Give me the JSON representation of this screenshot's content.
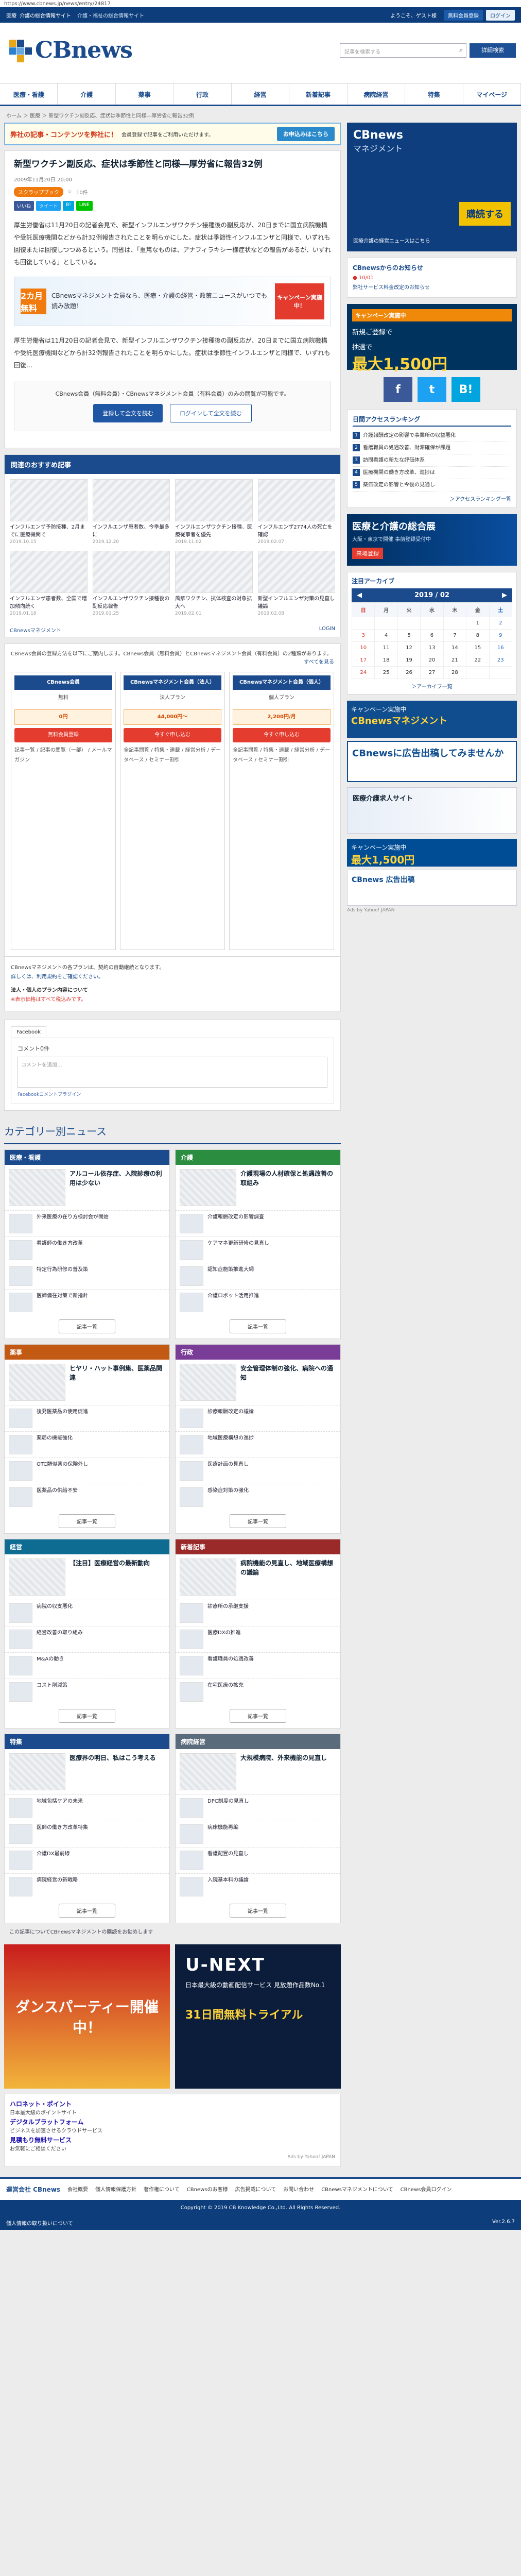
{
  "url": "https://www.cbnews.jp/news/entry/24817",
  "topbar": {
    "links": [
      "医療",
      "介護の総合情報サイト"
    ],
    "tagline": "介護・福祉の総合情報サイト",
    "welcome": "ようこそ、ゲスト様",
    "register": "無料会員登録",
    "login": "ログイン"
  },
  "header": {
    "logo_text": "CBnews",
    "search_placeholder": "記事を検索する",
    "search_button": "詳細検索"
  },
  "nav": [
    "医療・看護",
    "介護",
    "薬事",
    "行政",
    "経営",
    "新着記事",
    "病院経営",
    "特集",
    "マイページ"
  ],
  "breadcrumb": "ホーム ＞ 医療 ＞ 新型ワクチン副反応、症状は季節性と同様―厚労省に報告32例",
  "banner": {
    "title": "弊社の記事・コンテンツを弊社に！",
    "note": "会員登録で記事をご利用いただけます。",
    "cta": "お申込みはこちら"
  },
  "article": {
    "title": "新型ワクチン副反応、症状は季節性と同様―厚労省に報告32例",
    "date": "2009年11月20日 20:00",
    "tag": "スクラップブック",
    "share_count": "10件",
    "sns": [
      "いいね",
      "ツイート",
      "B!",
      "LINE"
    ],
    "body": "厚生労働省は11月20日の記者会見で、新型インフルエンザワクチン接種後の副反応が、20日までに国立病院機構や受託医療機関などから計32例報告されたことを明らかにした。症状は季節性インフルエンザと同様で、いずれも回復または回復しつつあるという。同省は、「重篤なものは、アナフィラキシー様症状などの報告があるが、いずれも回復している」としている。",
    "body2": "厚生労働省は11月20日の記者会見で、新型インフルエンザワクチン接種後の副反応が、20日までに国立病院機構や受託医療機関などから計32例報告されたことを明らかにした。症状は季節性インフルエンザと同様で、いずれも回復…",
    "promo_label": "2カ月無料",
    "promo_text": "CBnewsマネジメント会員なら、医療・介護の経営・政策ニュースがいつでも読み放題！",
    "promo_campaign": "キャンペーン実施中！",
    "login_text": "CBnews会員（無料会員）・CBnewsマネジメント会員（有料会員）のみの閲覧が可能です。",
    "login_btn1": "登録して全文を読む",
    "login_btn2": "ログインして全文を読む"
  },
  "recommended": {
    "title": "関連のおすすめ記事",
    "items": [
      {
        "text": "インフルエンザ予防接種、2月までに医療機関で",
        "date": "2019.10.15"
      },
      {
        "text": "インフルエンザ患者数、今季最多に",
        "date": "2019.12.20"
      },
      {
        "text": "インフルエンザワクチン接種、医療従事者を優先",
        "date": "2019.11.02"
      },
      {
        "text": "インフルエンザ2774人の死亡を確認",
        "date": "2019.02.07"
      },
      {
        "text": "インフルエンザ患者数、全国で増加傾向続く",
        "date": "2019.01.18"
      },
      {
        "text": "インフルエンザワクチン接種後の副反応報告",
        "date": "2019.01.25"
      },
      {
        "text": "風疹ワクチン、抗体検査の対象拡大へ",
        "date": "2019.02.01"
      },
      {
        "text": "新型インフルエンザ対策の見直し議論",
        "date": "2019.02.08"
      }
    ]
  },
  "promo_inline": {
    "left": "CBnewsマネジメント",
    "right": "LOGIN"
  },
  "plans": {
    "intro": "CBnews会員の登録方法を以下にご案内します。CBnews会員（無料会員）とCBnewsマネジメント会員（有料会員）の2種類があります。",
    "title": "すべてを見る",
    "cols": [
      {
        "head": "CBnews会員",
        "sub": "無料",
        "price": "0円",
        "cta": "無料会員登録",
        "feat": "記事一覧 / 記事の閲覧（一部） / メールマガジン"
      },
      {
        "head": "CBnewsマネジメント会員（法人）",
        "sub": "法人プラン",
        "price": "44,000円〜",
        "cta": "今すぐ申し込む",
        "feat": "全記事閲覧 / 特集・連載 / 経営分析 / データベース / セミナー割引"
      },
      {
        "head": "CBnewsマネジメント会員（個人）",
        "sub": "個人プラン",
        "price": "2,200円/月",
        "cta": "今すぐ申し込む",
        "feat": "全記事閲覧 / 特集・連載 / 経営分析 / データベース / セミナー割引"
      }
    ]
  },
  "info": {
    "line1": "CBnewsマネジメントの各プランは、契約の自動継続となります。",
    "line2": "詳しくは、利用規約をご確認ください。",
    "line3": "法人・個人のプラン内容について",
    "red": "※表示価格はすべて税込みです。"
  },
  "facebook": {
    "tab": "Facebook",
    "comments": "コメント0件",
    "placeholder": "コメントを追加...",
    "plugin": "Facebookコメントプラグイン"
  },
  "categories": {
    "title": "カテゴリー別ニュース",
    "blocks": [
      {
        "name": "医療・看護",
        "color": "#1b4b8c",
        "feat": "アルコール依存症、入院診療の利用は少ない",
        "items": [
          "外来医療の在り方検討会が開始",
          "看護師の働き方改革",
          "特定行為研修の普及策",
          "医師偏在対策で新指針"
        ],
        "more": "記事一覧"
      },
      {
        "name": "介護",
        "color": "#2a8d3f",
        "feat": "介護現場の人材確保と処遇改善の取組み",
        "items": [
          "介護報酬改定の影響調査",
          "ケアマネ更新研修の見直し",
          "認知症施策推進大綱",
          "介護ロボット活用推進"
        ],
        "more": "記事一覧"
      },
      {
        "name": "薬事",
        "color": "#c25a14",
        "feat": "ヒヤリ・ハット事例集、医薬品関連",
        "items": [
          "後発医薬品の使用促進",
          "薬局の機能強化",
          "OTC類似薬の保険外し",
          "医薬品の供給不安"
        ],
        "more": "記事一覧"
      },
      {
        "name": "行政",
        "color": "#7a3d97",
        "feat": "安全管理体制の強化、病院への通知",
        "items": [
          "診療報酬改定の議論",
          "地域医療構想の進捗",
          "医療計画の見直し",
          "感染症対策の強化"
        ],
        "more": "記事一覧"
      },
      {
        "name": "経営",
        "color": "#0e6c93",
        "feat": "【注目】医療経営の最新動向",
        "items": [
          "病院の収支悪化",
          "経営改善の取り組み",
          "M&Aの動き",
          "コスト削減策"
        ],
        "more": "記事一覧"
      },
      {
        "name": "新着記事",
        "color": "#9a2a2a",
        "feat": "病院機能の見直し、地域医療構想の議論",
        "items": [
          "診療所の承継支援",
          "医療DXの推進",
          "看護職員の処遇改善",
          "在宅医療の拡充"
        ],
        "more": "記事一覧"
      },
      {
        "name": "特集",
        "color": "#1b4b8c",
        "feat": "医療界の明日、私はこう考える",
        "items": [
          "地域包括ケアの未来",
          "医師の働き方改革特集",
          "介護DX最前線",
          "病院経営の新戦略"
        ],
        "more": "記事一覧"
      },
      {
        "name": "病院経営",
        "color": "#5a6b7c",
        "feat": "大規模病院、外来機能の見直し",
        "items": [
          "DPC制度の見直し",
          "病床機能再編",
          "看護配置の見直し",
          "入院基本料の議論"
        ],
        "more": "記事一覧"
      }
    ]
  },
  "link_row": "この記事についてCBnewsマネジメントの購読をお勧めします",
  "ads": {
    "ad1": "ダンスパーティー開催中！",
    "ad2_title": "U-NEXT",
    "ad2_text": "日本最大級の動画配信サービス 見放題作品数No.1",
    "ad2_free": "31日間無料トライアル"
  },
  "textads": [
    {
      "t": "ハロネット・ポイント",
      "d": "日本最大級のポイントサイト"
    },
    {
      "t": "デジタルブラットフォーム",
      "d": "ビジネスを加速させるクラウドサービス"
    },
    {
      "t": "見積もり無料サービス",
      "d": "お気軽にご相談ください"
    }
  ],
  "textads_note": "Ads by Yahoo! JAPAN",
  "side": {
    "ad_title": "CBnews",
    "ad_sub": "マネジメント",
    "ad_btn": "購読する",
    "ad_line": "医療介護の経営ニュースはこちら",
    "notice_title": "CBnewsからのお知らせ",
    "notice_date": "● 10/01",
    "notice_link": "弊社サービス料金改定のお知らせ",
    "campaign_head": "キャンペーン実施中",
    "campaign_body": "抽選で",
    "campaign_amt": "最大1,500円",
    "campaign_note": "新規ご登録で",
    "social": [
      "f",
      "t",
      "B!"
    ],
    "rank_title": "日間アクセスランキング",
    "rank": [
      "介護報酬改定の影響で事業所の収益悪化",
      "看護職員の処遇改善、財源確保が課題",
      "訪問看護の新たな評価体系",
      "医療機関の働き方改革、進捗は",
      "薬価改定の影響と今後の見通し"
    ],
    "rank_link": "＞アクセスランキング一覧",
    "medical_title": "医療と介護の総合展",
    "medical_sub": "大阪・東京で開催 事前登録受付中",
    "medical_tag": "来場登録",
    "cal_title": "注目アーカイブ",
    "cal_month": "2019 / 02",
    "cal_days": [
      "日",
      "月",
      "火",
      "水",
      "木",
      "金",
      "土"
    ],
    "cal_rows": [
      [
        "",
        "",
        "",
        "",
        "",
        "1",
        "2"
      ],
      [
        "3",
        "4",
        "5",
        "6",
        "7",
        "8",
        "9"
      ],
      [
        "10",
        "11",
        "12",
        "13",
        "14",
        "15",
        "16"
      ],
      [
        "17",
        "18",
        "19",
        "20",
        "21",
        "22",
        "23"
      ],
      [
        "24",
        "25",
        "26",
        "27",
        "28",
        "",
        ""
      ]
    ],
    "cal_link": "＞アーカイブ一覧",
    "b1": "キャンペーン実施中",
    "b1y": "CBnewsマネジメント",
    "b2": "CBnewsに広告出稿してみませんか",
    "b3": "医療介護求人サイト",
    "b4": "キャンペーン実施中",
    "b4y": "最大1,500円",
    "b5": "CBnews 広告出稿",
    "ad_note": "Ads by Yahoo! JAPAN"
  },
  "footer": {
    "company": "運営会社 CBnews",
    "links": [
      "会社概要",
      "個人情報保護方針",
      "著作権について",
      "CBnewsのお客様",
      "広告掲載について",
      "お問い合わせ",
      "CBnewsマネジメントについて",
      "CBnews会員ログイン"
    ],
    "copyright": "Copyright © 2019 CB Knowledge Co.,Ltd. All Rights Reserved.",
    "privacy": "個人情報の取り扱いについて",
    "version": "Ver.2.6.7"
  }
}
